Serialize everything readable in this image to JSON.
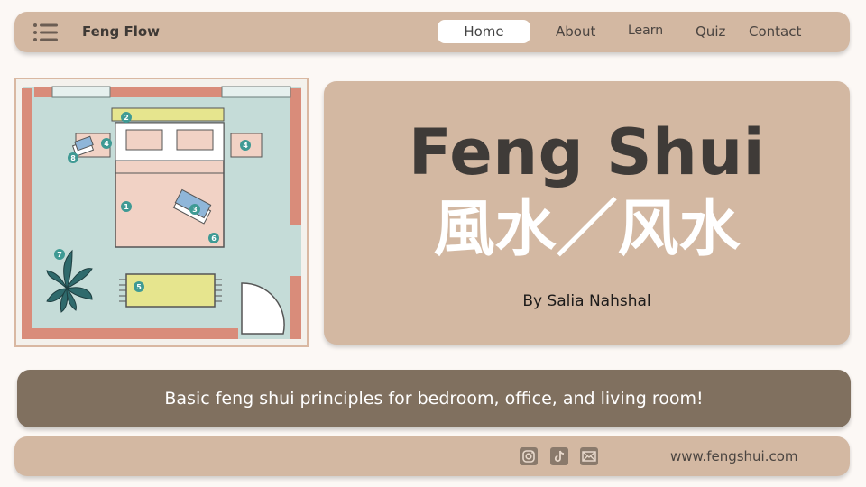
{
  "nav": {
    "brand": "Feng Flow",
    "menu_icon": "hamburger-menu-icon",
    "links": [
      {
        "label": "Home",
        "active": true
      },
      {
        "label": "About"
      },
      {
        "label": "Learn"
      },
      {
        "label": "Quiz"
      },
      {
        "label": "Contact"
      }
    ]
  },
  "floorplan": {
    "markers": [
      "1",
      "2",
      "3",
      "4",
      "4",
      "5",
      "6",
      "7",
      "8"
    ]
  },
  "hero": {
    "title": "Feng Shui",
    "chinese": "風水／风水",
    "author": "By Salia Nahshal"
  },
  "tagline": "Basic feng shui principles for bedroom, office, and living room!",
  "footer": {
    "social_icons": [
      "instagram-icon",
      "tiktok-icon",
      "email-icon"
    ],
    "url": "www.fengshui.com"
  },
  "colors": {
    "background": "#fcf8f5",
    "panel": "#d3b8a2",
    "tagline_bar": "#80705f",
    "title_dark": "#3f3b38",
    "title_light": "#ffffff",
    "room_floor": "#c5dcd8",
    "wall": "#d98c7a",
    "marker": "#3f9a94"
  }
}
